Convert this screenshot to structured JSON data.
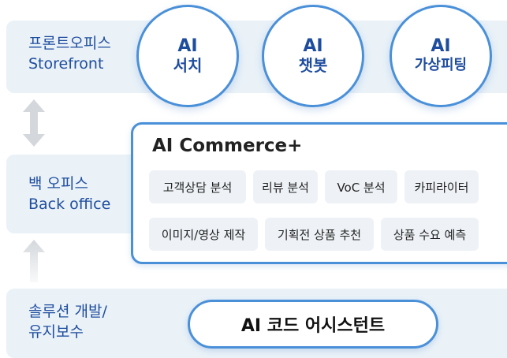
{
  "front": {
    "label_ko": "프론트오피스",
    "label_en": "Storefront",
    "services": [
      {
        "ai": "AI",
        "name": "서치"
      },
      {
        "ai": "AI",
        "name": "챗봇"
      },
      {
        "ai": "AI",
        "name": "가상피팅"
      }
    ]
  },
  "back": {
    "label_ko": "백 오피스",
    "label_en": "Back office",
    "commerce_title": "AI Commerce+",
    "chips": [
      "고객상담 분석",
      "리뷰 분석",
      "VoC 분석",
      "카피라이터",
      "이미지/영상 제작",
      "기획전 상품 추천",
      "상품 수요 예측"
    ]
  },
  "solution": {
    "label_line1": "솔루션 개발/",
    "label_line2": "유지보수",
    "tool": "AI 코드 어시스턴트"
  },
  "colors": {
    "band": "#eaf2f8",
    "accent": "#4a90d9",
    "label_text": "#1f4d9e",
    "arrow": "#d4d8dc"
  }
}
